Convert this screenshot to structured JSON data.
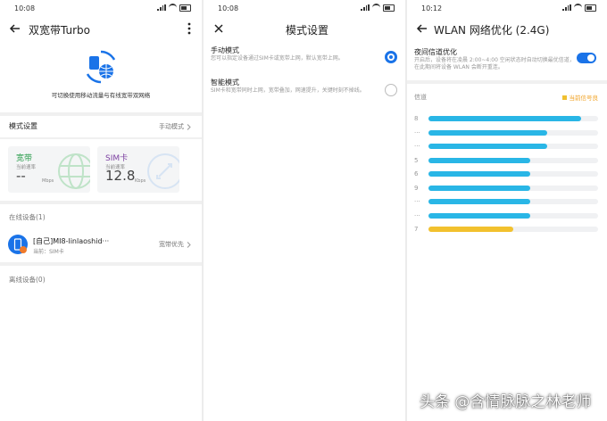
{
  "panel1": {
    "status_time": "10:08",
    "title": "双宽带Turbo",
    "hero_desc": "可切换使用移动流量与有线宽带双网络",
    "mode_label": "模式设置",
    "mode_value": "手动模式",
    "card_broadband": {
      "title": "宽带",
      "sub": "当前速率",
      "value": "--",
      "unit": "Mbps",
      "color": "#2e9e4f"
    },
    "card_sim": {
      "title": "SIM卡",
      "sub": "当前速率",
      "value": "12.8",
      "unit": "Kbps",
      "color": "#7b3fa0"
    },
    "online_label": "在线设备(1)",
    "device": {
      "name": "[自己]MI8-linlaoshid···",
      "sub": "当前：SIM卡",
      "action": "宽带优先"
    },
    "offline_label": "离线设备(0)"
  },
  "panel2": {
    "status_time": "10:08",
    "title": "模式设置",
    "options": [
      {
        "title": "手动模式",
        "desc": "您可以指定设备通过SIM卡或宽带上网，默认宽带上网。",
        "selected": true
      },
      {
        "title": "智能模式",
        "desc": "SIM卡和宽带同时上网，宽带叠加，网速提升，关键时刻不掉线。",
        "selected": false
      }
    ]
  },
  "panel3": {
    "status_time": "10:12",
    "title": "WLAN 网络优化 (2.4G)",
    "night_title": "夜间信道优化",
    "night_desc": "开启后，设备将在凌晨 2:00~4:00 空闲状态时自动切换最优信道，在此期间将设备 WLAN 会断开重连。",
    "channel_header": "信道",
    "legend_label": "当前信号良",
    "colors": {
      "accent": "#1a73e8",
      "bar": "#29b6e6",
      "current": "#f2c12e"
    }
  },
  "chart_data": {
    "type": "bar",
    "orientation": "horizontal",
    "categories": [
      "8",
      "···",
      "···",
      "5",
      "6",
      "9",
      "···",
      "···",
      "7"
    ],
    "values": [
      0.9,
      0.7,
      0.7,
      0.6,
      0.6,
      0.6,
      0.6,
      0.6,
      0.5
    ],
    "highlight_category": "7",
    "xlim": [
      0,
      1
    ]
  },
  "watermark": "头条 @含情脉脉之林老师"
}
